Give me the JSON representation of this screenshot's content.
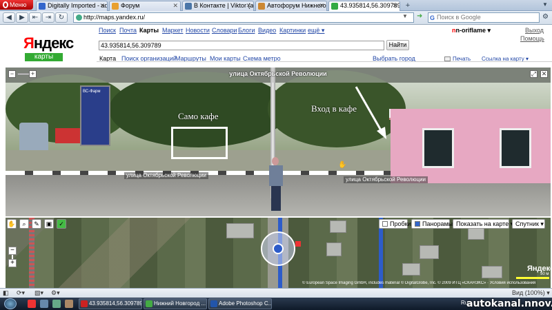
{
  "browser": {
    "menu_label": "Меню",
    "tabs": [
      {
        "title": "Digitally Imported - ad...",
        "color": "#3366cc",
        "active": false
      },
      {
        "title": "Форум",
        "color": "#e8a030",
        "active": false
      },
      {
        "title": "В Контакте | Viktor (ac...",
        "color": "#4a76a8",
        "active": false
      },
      {
        "title": "Автофорум Нижнего ...",
        "color": "#cc8833",
        "active": false
      },
      {
        "title": "43.935814,56.309789 —...",
        "color": "#33aa44",
        "active": true
      }
    ],
    "url": "http://maps.yandex.ru/",
    "search_placeholder": "Поиск в Google",
    "search_engine_glyph": "G"
  },
  "yandex": {
    "logo": "Яндекс",
    "logo_first_letter": "Я",
    "logo_rest": "ндекс",
    "service": "карты",
    "nav": [
      "Поиск",
      "Почта",
      "Карты",
      "Маркет",
      "Новости",
      "Словари",
      "Блоги",
      "Видео",
      "Картинки",
      "ещё ▾"
    ],
    "user_first": "n",
    "user_rest": "n-oriflame ▾",
    "logout": "Выход",
    "help": "Помощь",
    "search_value": "43.935814,56.309789",
    "find_button": "Найти",
    "subnav": [
      "Карта",
      "Поиск организаций",
      "Маршруты",
      "Мои карты",
      "Схема метро"
    ],
    "choose_city": "Выбрать город",
    "print": "Печать",
    "map_link": "Ссылка на карту ▾"
  },
  "panorama": {
    "street_title": "улица Октябрьской Революции",
    "cafe_label": "Само кафе",
    "entry_label": "Вход в кафе",
    "street_tag_left": "улица Октябрьской Революции",
    "street_tag_right": "улица Октябрьской Революции",
    "stand_label": "ВС-Фарм"
  },
  "map": {
    "controls": {
      "traffic": "Пробки",
      "panoramas": "Панорамы",
      "show_on_map": "Показать на карте ▾",
      "satellite": "Спутник ▾"
    },
    "logo": "Яндекс",
    "scale": "50 м",
    "copyright": "© European Space Imaging GmbH, includes material © DigitalGlobe, Inc. © 2009 ИТЦ «СКАНЭКС» · Условия использования"
  },
  "statusbar": {
    "zoom": "Вид (100%) ▾"
  },
  "taskbar": {
    "tasks": [
      {
        "title": "43.935814,56.309789...",
        "color": "#cc2222"
      },
      {
        "title": "Нижний Новгород ...",
        "color": "#44aa44"
      },
      {
        "title": "Adobe Photoshop C...",
        "color": "#2255aa"
      }
    ],
    "tray": "Ru"
  },
  "watermark": "autokanal.nnov.ru"
}
